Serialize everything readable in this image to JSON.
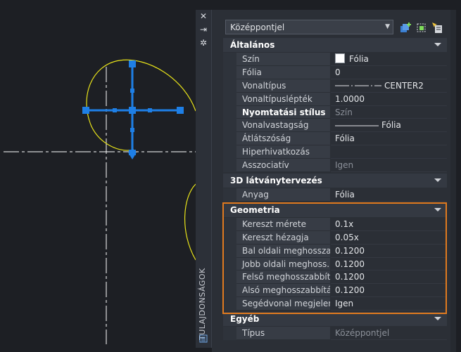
{
  "palette": {
    "title": "TULAJDONSÁGOK",
    "close_glyph": "✕",
    "autohide_glyph": "⇥",
    "settings_glyph": "✲"
  },
  "selector": {
    "value": "Középpontjel"
  },
  "categories": [
    {
      "label": "Általános",
      "rows": [
        {
          "name": "Szín",
          "value": "Fólia",
          "swatch": true
        },
        {
          "name": "Fólia",
          "value": "0"
        },
        {
          "name": "Vonaltípus",
          "value": "CENTER2",
          "linetype": "center"
        },
        {
          "name": "Vonaltípuslépték",
          "value": "1.0000"
        },
        {
          "name": "Nyomtatási stílus",
          "value": "Szín",
          "bold": true,
          "dim": true
        },
        {
          "name": "Vonalvastagság",
          "value": "Fólia",
          "linetype": "solid"
        },
        {
          "name": "Átlátszóság",
          "value": "Fólia"
        },
        {
          "name": "Hiperhivatkozás",
          "value": ""
        },
        {
          "name": "Asszociatív",
          "value": "Igen",
          "dim": true
        }
      ]
    },
    {
      "label": "3D látványtervezés",
      "rows": [
        {
          "name": "Anyag",
          "value": "Fólia"
        }
      ]
    },
    {
      "label": "Geometria",
      "rows": [
        {
          "name": "Kereszt mérete",
          "value": "0.1x"
        },
        {
          "name": "Kereszt hézagja",
          "value": "0.05x"
        },
        {
          "name": "Bal oldali meghossza...",
          "value": "0.1200"
        },
        {
          "name": "Jobb oldali meghoss...",
          "value": "0.1200"
        },
        {
          "name": "Felső meghosszabbítás",
          "value": "0.1200"
        },
        {
          "name": "Alsó meghosszabbítás",
          "value": "0.1200"
        },
        {
          "name": "Segédvonal megjelen...",
          "value": "Igen"
        }
      ]
    },
    {
      "label": "Egyéb",
      "rows": [
        {
          "name": "Típus",
          "value": "Középpontjel",
          "dim": true
        }
      ]
    }
  ],
  "colors": {
    "highlight": "#e07a1f",
    "grip": "#1e7fe6",
    "arc": "#e8e31a",
    "background": "#1d1f24"
  }
}
